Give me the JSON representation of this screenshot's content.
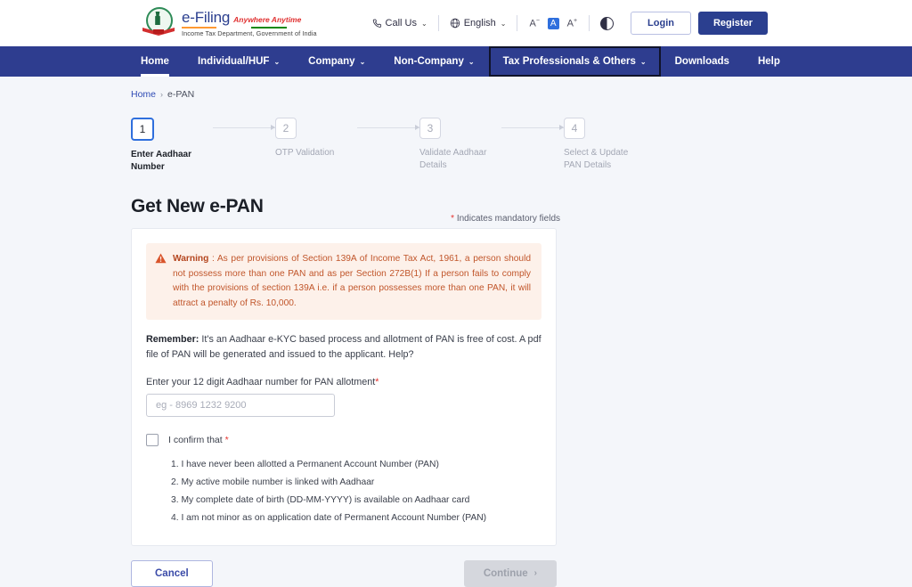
{
  "header": {
    "logo": {
      "emblem_icon": "india-emblem-icon",
      "brand": "e-Filing",
      "tagline": "Anywhere Anytime",
      "department": "Income Tax Department, Government of India"
    },
    "call_us": {
      "label": "Call Us",
      "icon": "phone-icon",
      "chevron": "⌄"
    },
    "language": {
      "label": "English",
      "icon": "globe-icon",
      "chevron": "⌄"
    },
    "font_size": {
      "decrease": "A",
      "decrease_sup": "−",
      "normal": "A",
      "increase": "A",
      "increase_sup": "+"
    },
    "contrast_icon": "contrast-toggle-icon",
    "login_label": "Login",
    "register_label": "Register"
  },
  "nav": {
    "items": [
      {
        "label": "Home",
        "has_dropdown": false,
        "active": true,
        "focused": false
      },
      {
        "label": "Individual/HUF",
        "has_dropdown": true,
        "active": false,
        "focused": false
      },
      {
        "label": "Company",
        "has_dropdown": true,
        "active": false,
        "focused": false
      },
      {
        "label": "Non-Company",
        "has_dropdown": true,
        "active": false,
        "focused": false
      },
      {
        "label": "Tax Professionals & Others",
        "has_dropdown": true,
        "active": false,
        "focused": true
      },
      {
        "label": "Downloads",
        "has_dropdown": false,
        "active": false,
        "focused": false
      },
      {
        "label": "Help",
        "has_dropdown": false,
        "active": false,
        "focused": false
      }
    ],
    "chevron": "⌄"
  },
  "breadcrumb": {
    "home": "Home",
    "separator": "›",
    "current": "e-PAN"
  },
  "stepper": {
    "steps": [
      {
        "number": "1",
        "label": "Enter Aadhaar Number",
        "active": true
      },
      {
        "number": "2",
        "label": "OTP Validation",
        "active": false
      },
      {
        "number": "3",
        "label": "Validate Aadhaar Details",
        "active": false
      },
      {
        "number": "4",
        "label": "Select & Update PAN Details",
        "active": false
      }
    ]
  },
  "main": {
    "title": "Get New e-PAN",
    "mandatory_star": "*",
    "mandatory_note": "Indicates mandatory fields",
    "warning": {
      "icon": "warning-triangle-icon",
      "label": "Warning",
      "separator": " : ",
      "text": "As per provisions of Section 139A of Income Tax Act, 1961, a person should not possess more than one PAN and as per Section 272B(1) If a person fails to comply with the provisions of section 139A i.e. if a person possesses more than one PAN, it will attract a penalty of Rs. 10,000."
    },
    "remember": {
      "label": "Remember:",
      "text": " It's an Aadhaar e-KYC based process and allotment of PAN is free of cost. A pdf file of PAN will be generated and issued to the applicant. Help?"
    },
    "aadhaar_field": {
      "label": "Enter your 12 digit Aadhaar number for PAN allotment",
      "required_star": "*",
      "placeholder": "eg - 8969 1232 9200",
      "value": ""
    },
    "confirm": {
      "label": "I confirm that",
      "required_star": "*",
      "checked": false,
      "items": [
        "1. I have never been allotted a Permanent Account Number (PAN)",
        "2. My active mobile number is linked with Aadhaar",
        "3. My complete date of birth (DD-MM-YYYY) is available on Aadhaar card",
        "4. I am not minor as on application date of Permanent Account Number (PAN)"
      ]
    },
    "actions": {
      "cancel_label": "Cancel",
      "continue_label": "Continue",
      "continue_chevron": "›",
      "continue_disabled": true
    }
  },
  "colors": {
    "nav_bg": "#2e3d8f",
    "brand_indigo": "#2b3f8f",
    "accent_blue": "#2f6fdd",
    "warning_bg": "#fdf1ea",
    "warning_text": "#c1562b",
    "required_red": "#e5322d",
    "page_bg": "#f4f6fa"
  }
}
